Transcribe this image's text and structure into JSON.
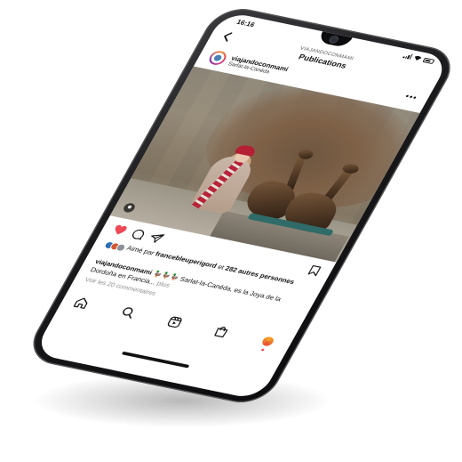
{
  "status_bar": {
    "time": "16:16"
  },
  "header": {
    "subtitle": "VIAJANDOCONMAMI",
    "title": "Publications"
  },
  "post": {
    "username": "viajandoconmami",
    "location": "Sarlat-la-Canéda"
  },
  "likes": {
    "prefix": "Aimé par ",
    "liker": "francebleuperigord",
    "middle": " et ",
    "others": "282 autres personnes"
  },
  "caption": {
    "username": "viajandoconmami",
    "text": " 🦆🦆🦆 Sarlat-la-Canéda, es la Joya de la Dordoña en Francia...",
    "more": " plus"
  },
  "comments": {
    "label": "Voir les 20 commentaires"
  },
  "colors": {
    "like_red": "#ed4956",
    "text": "#111111",
    "muted": "#8e8e8e",
    "bezel": "#1b1b1e"
  },
  "icons": {
    "back": "back-arrow-icon",
    "more": "more-dots-icon",
    "like": "heart-icon",
    "comment": "comment-icon",
    "share": "send-icon",
    "save": "bookmark-icon",
    "home": "home-icon",
    "search": "search-icon",
    "reels": "reels-icon",
    "shop": "shop-bag-icon"
  }
}
